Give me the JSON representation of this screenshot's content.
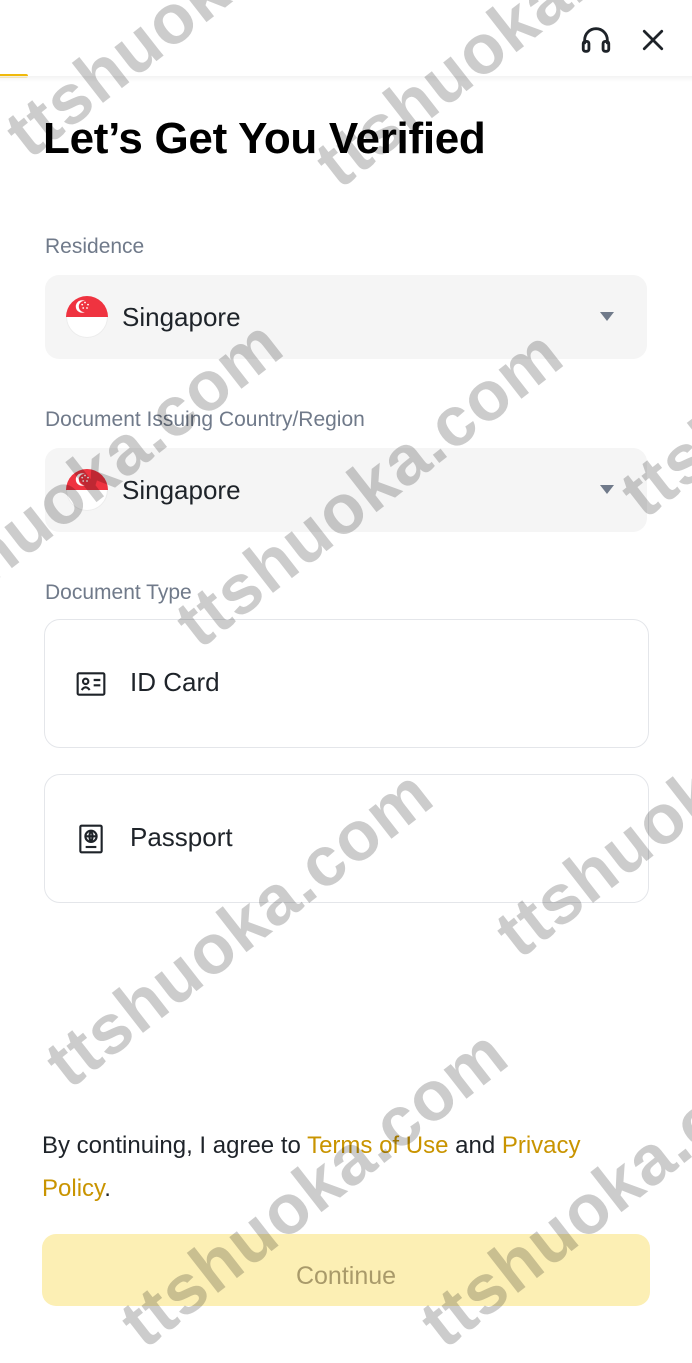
{
  "page": {
    "title": "Let’s Get You Verified"
  },
  "residence": {
    "label": "Residence",
    "value": "Singapore"
  },
  "issuing_country": {
    "label": "Document Issuing Country/Region",
    "value": "Singapore"
  },
  "document_type": {
    "label": "Document Type",
    "options": [
      {
        "label": "ID Card",
        "icon": "id-card-icon"
      },
      {
        "label": "Passport",
        "icon": "passport-icon"
      }
    ]
  },
  "agreement": {
    "prefix": "By continuing, I agree to ",
    "terms_link": "Terms of Use",
    "middle": " and ",
    "privacy_link": "Privacy Policy",
    "suffix": "."
  },
  "continue_button": {
    "label": "Continue"
  },
  "watermark": {
    "text": "ttshuoka.com"
  },
  "colors": {
    "accent": "#f0b90b",
    "link": "#c99400",
    "flag_red": "#ef3340",
    "button_disabled": "#fcefb4"
  },
  "icons": {
    "support": "headset-icon",
    "close": "close-icon",
    "dropdown": "caret-down-icon",
    "flag": "singapore-flag-icon"
  }
}
